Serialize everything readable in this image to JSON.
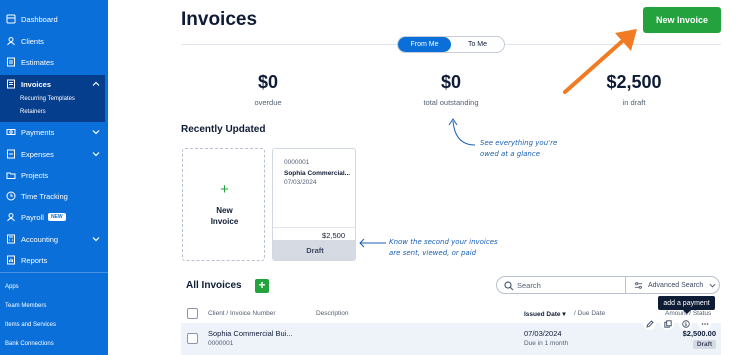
{
  "sidebar": {
    "items": [
      {
        "label": "Dashboard",
        "icon": "dashboard-icon"
      },
      {
        "label": "Clients",
        "icon": "clients-icon"
      },
      {
        "label": "Estimates",
        "icon": "estimates-icon"
      },
      {
        "label": "Invoices",
        "icon": "invoices-icon"
      },
      {
        "label": "Payments",
        "icon": "payments-icon"
      },
      {
        "label": "Expenses",
        "icon": "expenses-icon"
      },
      {
        "label": "Projects",
        "icon": "projects-icon"
      },
      {
        "label": "Time Tracking",
        "icon": "clock-icon"
      },
      {
        "label": "Payroll",
        "icon": "payroll-icon",
        "badge": "NEW"
      },
      {
        "label": "Accounting",
        "icon": "accounting-icon"
      },
      {
        "label": "Reports",
        "icon": "reports-icon"
      }
    ],
    "invoices_sub": [
      "Recurring Templates",
      "Retainers"
    ],
    "bottom": [
      "Apps",
      "Team Members",
      "Items and Services",
      "Bank Connections"
    ],
    "bg_color": "#0a6fd9",
    "active_color": "#063e8e"
  },
  "header": {
    "title": "Invoices",
    "new_invoice_label": "New Invoice",
    "toggle": {
      "from_me": "From Me",
      "to_me": "To Me",
      "selected": "From Me"
    }
  },
  "stats": [
    {
      "value": "$0",
      "label": "overdue"
    },
    {
      "value": "$0",
      "label": "total outstanding"
    },
    {
      "value": "$2,500",
      "label": "in draft"
    }
  ],
  "recently_updated": {
    "title": "Recently Updated",
    "new_card": {
      "plus": "+",
      "line1": "New",
      "line2": "Invoice"
    },
    "invoice_card": {
      "number": "0000001",
      "client": "Sophia Commercial...",
      "date": "07/03/2024",
      "amount": "$2,500",
      "status": "Draft"
    }
  },
  "annotations": {
    "glance_1": "See everything you're",
    "glance_2": "owed at a glance",
    "status_1": "Know the second your invoices",
    "status_2": "are sent, viewed, or paid"
  },
  "all_invoices": {
    "title": "All Invoices",
    "add_label": "+",
    "search_placeholder": "Search",
    "advanced_search": "Advanced Search",
    "columns": {
      "client": "Client / Invoice Number",
      "description": "Description",
      "issued": "Issued Date",
      "due": "/ Due Date",
      "amount": "Amount / Status"
    },
    "tooltip": "add a payment",
    "rows": [
      {
        "client": "Sophia Commercial Bui...",
        "number": "0000001",
        "issued": "07/03/2024",
        "due": "Due in 1 month",
        "amount": "$2,500.00",
        "status": "Draft"
      }
    ]
  },
  "colors": {
    "accent_green": "#23a23e",
    "brand_blue": "#0a6fd9",
    "arrow_orange": "#f07b22"
  }
}
